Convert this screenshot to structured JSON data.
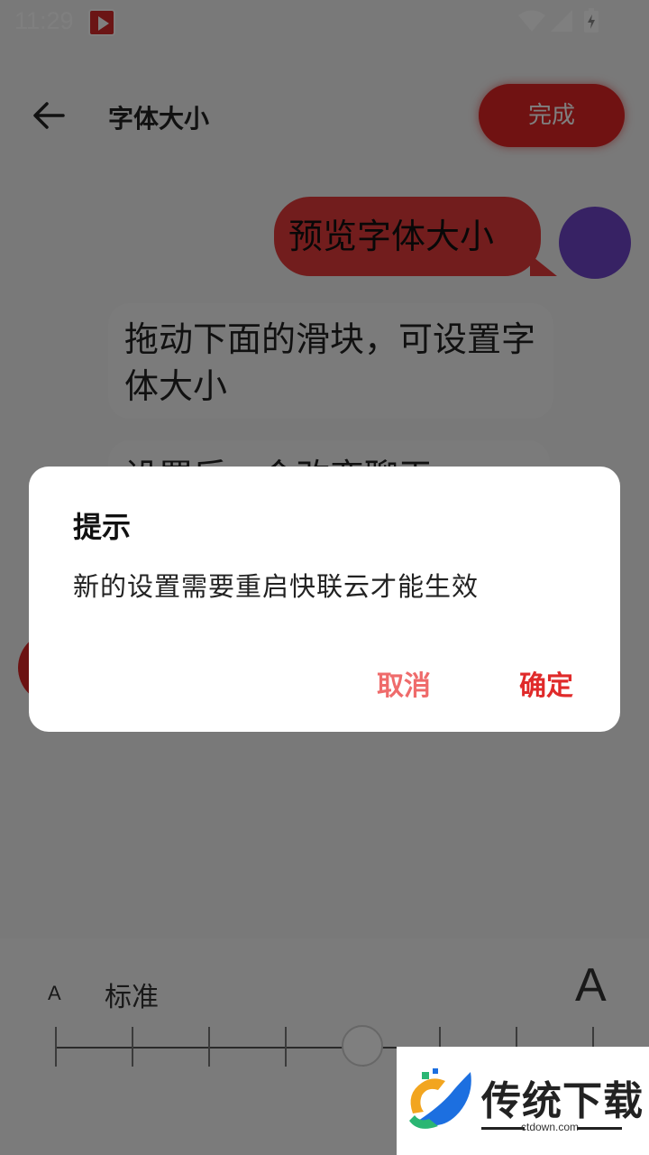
{
  "status_bar": {
    "time": "11:29"
  },
  "header": {
    "title": "字体大小",
    "done_label": "完成"
  },
  "chat": {
    "preview_bubble": "预览字体大小",
    "instruction_bubble": "拖动下面的滑块，可设置字体大小",
    "second_bubble": "设置后，会改变聊天"
  },
  "font_panel": {
    "small_a": "A",
    "level_label": "标准",
    "large_a": "A",
    "levels": 8,
    "selected_fraction": 0.571
  },
  "dialog": {
    "title": "提示",
    "message": "新的设置需要重启快联云才能生效",
    "cancel_label": "取消",
    "confirm_label": "确定"
  },
  "watermark": {
    "title": "传统下载",
    "url": "ctdown.com"
  },
  "colors": {
    "accent": "#e02a2a",
    "cancel": "#ef6b6b",
    "avatar": "#6f45c8"
  }
}
